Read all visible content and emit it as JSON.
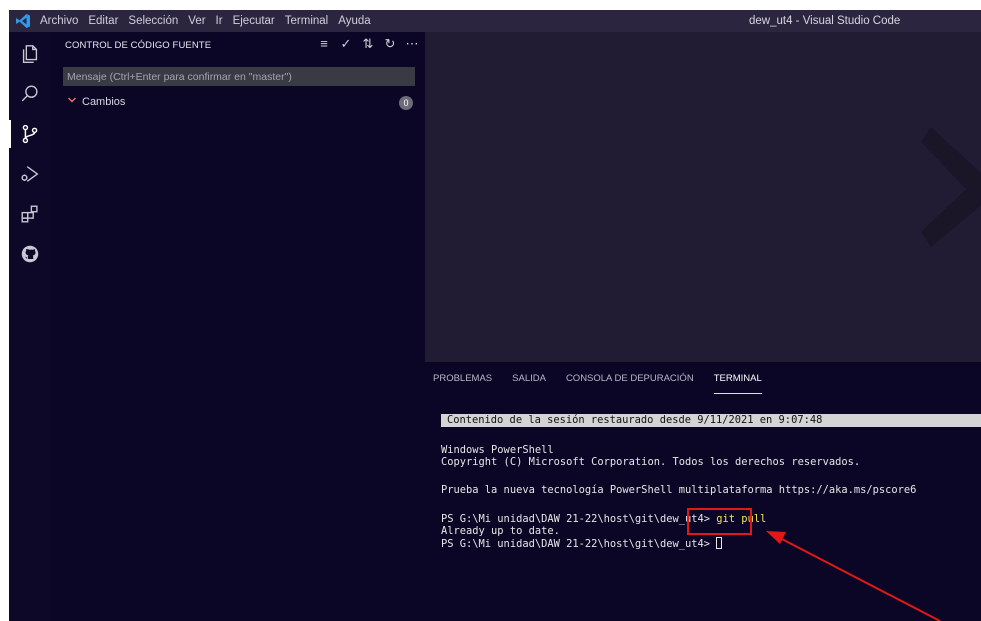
{
  "titlebar": {
    "menu": [
      "Archivo",
      "Editar",
      "Selección",
      "Ver",
      "Ir",
      "Ejecutar",
      "Terminal",
      "Ayuda"
    ],
    "window_title": "dew_ut4 - Visual Studio Code"
  },
  "activity_bar": {
    "icons": [
      "files-icon",
      "search-icon",
      "source-control-icon",
      "run-debug-icon",
      "extensions-icon",
      "github-icon"
    ],
    "active": "source-control-icon"
  },
  "sidebar": {
    "header": "CONTROL DE CÓDIGO FUENTE",
    "commit_placeholder": "Mensaje (Ctrl+Enter para confirmar en \"master\")",
    "changes_label": "Cambios",
    "changes_count": "0"
  },
  "panel": {
    "tabs": [
      "PROBLEMAS",
      "SALIDA",
      "CONSOLA DE DEPURACIÓN",
      "TERMINAL"
    ],
    "active_tab": "TERMINAL"
  },
  "terminal": {
    "restored": "Contenido de la sesión restaurado desde 9/11/2021 en 9:07:48",
    "line1": "Windows PowerShell",
    "line2": "Copyright (C) Microsoft Corporation. Todos los derechos reservados.",
    "line3": "Prueba la nueva tecnología PowerShell multiplataforma https://aka.ms/pscore6",
    "prompt": "PS G:\\Mi unidad\\DAW 21-22\\host\\git\\dew_ut4>",
    "command": "git pull",
    "output": "Already up to date.",
    "prompt2": "PS G:\\Mi unidad\\DAW 21-22\\host\\git\\dew_ut4>"
  },
  "colors": {
    "background": "#0c0626",
    "titlebar": "#2c2540",
    "editor": "#211c33",
    "annotation": "#e01818",
    "command": "#f2e55c"
  }
}
